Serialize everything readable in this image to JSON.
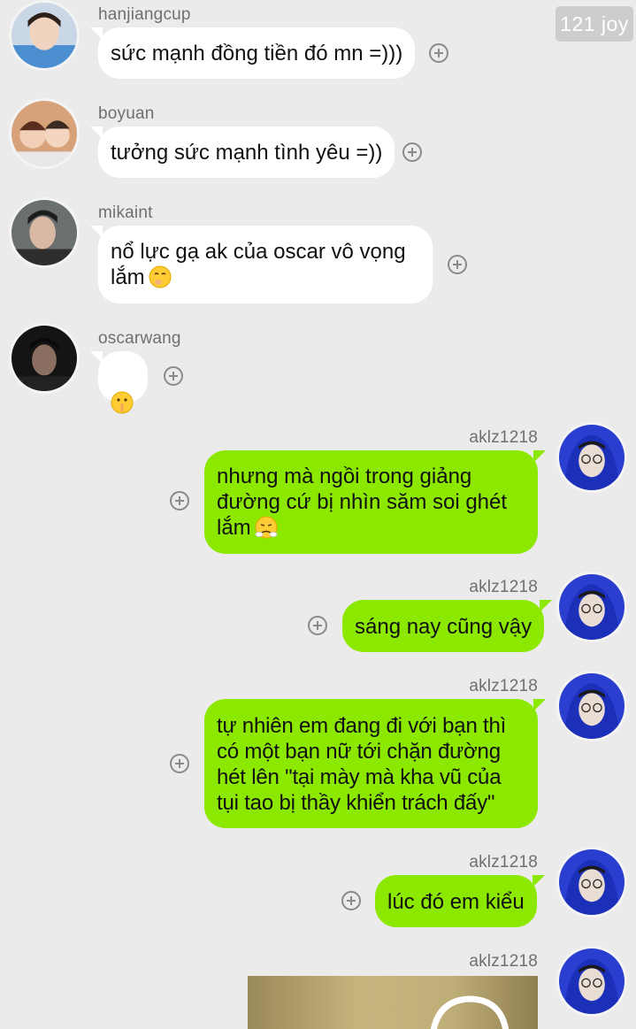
{
  "watermark": "121 joy",
  "messages": [
    {
      "user": "hanjiangcup",
      "text": "sức mạnh đồng tiền đó mn =)))",
      "side": "in"
    },
    {
      "user": "boyuan",
      "text": "tưởng sức mạnh tình yêu =))",
      "side": "in"
    },
    {
      "user": "mikaint",
      "line1": "nổ lực gạ ak của oscar vô vọng",
      "line2": "lắm",
      "emoji": "shushing-yawn-emoji",
      "side": "in"
    },
    {
      "user": "oscarwang",
      "emoji": "shushing-face-emoji",
      "side": "in"
    },
    {
      "user": "aklz1218",
      "line1": "nhưng mà ngồi trong giảng",
      "line2": "đường cứ bị nhìn săm soi ghét",
      "line3": "lắm",
      "emoji": "steam-nose-emoji",
      "side": "out"
    },
    {
      "user": "aklz1218",
      "text": "sáng nay cũng vậy",
      "side": "out"
    },
    {
      "user": "aklz1218",
      "text": "tự nhiên em đang đi với bạn thì\ncó một bạn nữ tới chặn đường\nhét lên \"tại mày mà kha vũ của\ntụi tao bị thầy khiển trách đấy\"",
      "side": "out"
    },
    {
      "user": "aklz1218",
      "text": "lúc đó em kiểu",
      "side": "out"
    },
    {
      "user": "aklz1218",
      "attachment": "image",
      "side": "out"
    }
  ],
  "colors": {
    "background": "#ebebeb",
    "incoming_bubble": "#ffffff",
    "outgoing_bubble": "#8de800",
    "username": "#6f6f6f"
  },
  "icons": {
    "add": "plus-circle-icon"
  }
}
